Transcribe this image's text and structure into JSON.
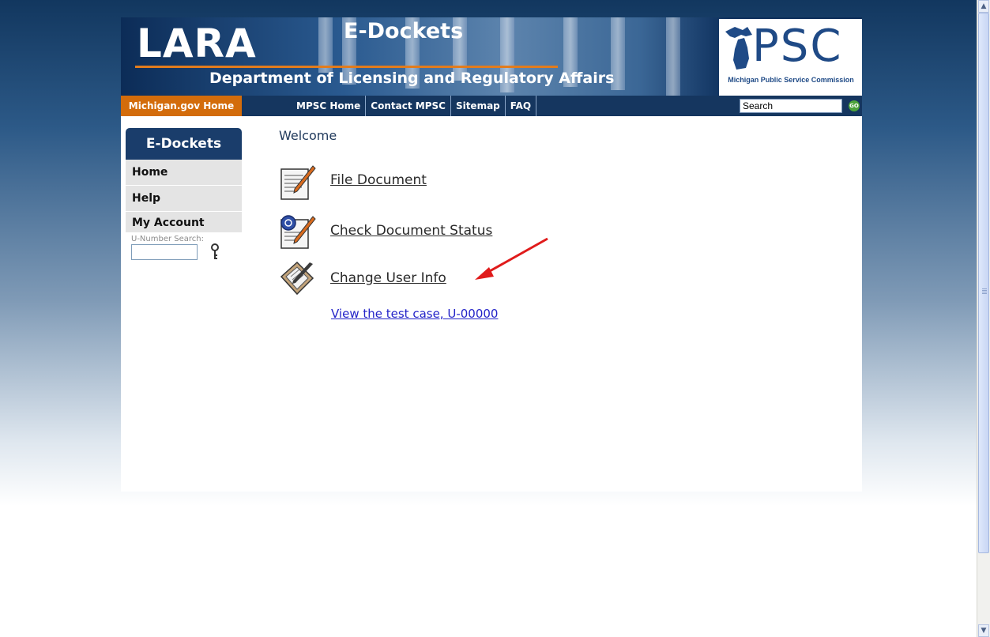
{
  "header": {
    "logo_text": "LARA",
    "title": "E-Dockets",
    "department": "Department of Licensing and Regulatory Affairs",
    "psc_logo_text": "PSC",
    "psc_name": "Michigan Public Service Commission"
  },
  "nav": {
    "home_label": "Michigan.gov Home",
    "links": [
      "MPSC Home",
      "Contact MPSC",
      "Sitemap",
      "FAQ"
    ],
    "search_value": "Search",
    "go_label": "GO"
  },
  "sidebar": {
    "header": "E-Dockets",
    "items": [
      {
        "label": "Home"
      },
      {
        "label": "Help"
      },
      {
        "label": "My Account"
      }
    ],
    "search_label": "U-Number Search:"
  },
  "main": {
    "welcome": "Welcome",
    "actions": [
      {
        "label": "File Document",
        "icon": "document-pencil-icon"
      },
      {
        "label": "Check Document Status",
        "icon": "document-check-icon"
      },
      {
        "label": "Change User Info",
        "icon": "clipboard-pen-icon"
      }
    ],
    "test_link": "View the test case, U-00000"
  },
  "colors": {
    "nav_bg": "#15365f",
    "home_tab": "#d36c0b",
    "sidebar_header": "#1a3d6b",
    "link": "#2323c8",
    "annotation_arrow": "#e01b1b"
  }
}
